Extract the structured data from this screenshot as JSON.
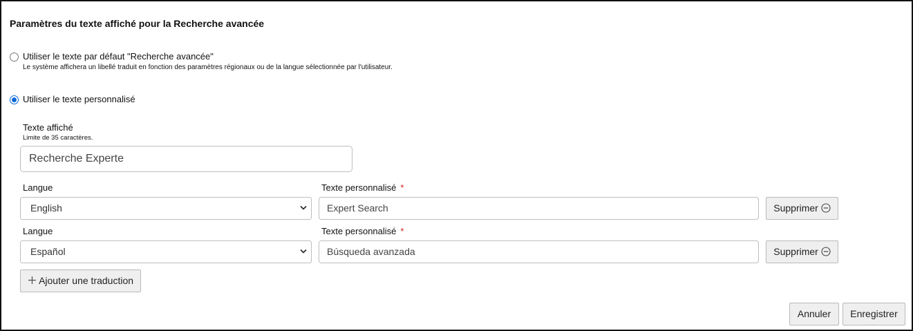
{
  "title": "Paramètres du texte affiché pour la Recherche avancée",
  "option_default": {
    "label": "Utiliser le texte par défaut \"Recherche avancée\"",
    "help": "Le système affichera un libellé traduit en fonction des paramètres régionaux ou de la langue sélectionnée par l'utilisateur.",
    "checked": false
  },
  "option_custom": {
    "label": "Utiliser le texte personnalisé",
    "checked": true
  },
  "display_text": {
    "label": "Texte affiché",
    "limit": "Limite de 35 caractères.",
    "value": "Recherche Experte"
  },
  "translations": [
    {
      "language_label": "Langue",
      "language_value": "English",
      "text_label": "Texte personnalisé",
      "required_mark": "*",
      "text_value": "Expert Search",
      "delete_label": "Supprimer"
    },
    {
      "language_label": "Langue",
      "language_value": "Español",
      "text_label": "Texte personnalisé",
      "required_mark": "*",
      "text_value": "Búsqueda avanzada",
      "delete_label": "Supprimer"
    }
  ],
  "add_translation_label": "Ajouter une traduction",
  "footer": {
    "cancel_label": "Annuler",
    "save_label": "Enregistrer"
  },
  "colors": {
    "radio_accent": "#0a68d8",
    "required": "#d02020",
    "button_bg": "#efefef"
  },
  "icons": {
    "delete": "minus-circle-icon",
    "add": "plus-icon",
    "select": "chevron-down-icon"
  }
}
